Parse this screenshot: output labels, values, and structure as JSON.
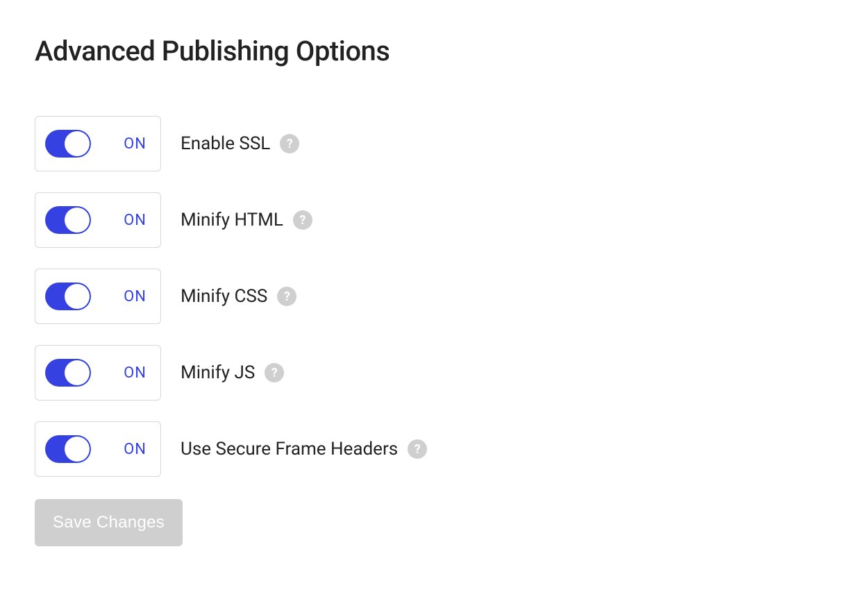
{
  "page": {
    "title": "Advanced Publishing Options"
  },
  "toggle": {
    "on_label": "ON"
  },
  "options": [
    {
      "label": "Enable SSL",
      "state": "on"
    },
    {
      "label": "Minify HTML",
      "state": "on"
    },
    {
      "label": "Minify CSS",
      "state": "on"
    },
    {
      "label": "Minify JS",
      "state": "on"
    },
    {
      "label": "Use Secure Frame Headers",
      "state": "on"
    }
  ],
  "actions": {
    "save_label": "Save Changes"
  },
  "help_glyph": "?"
}
